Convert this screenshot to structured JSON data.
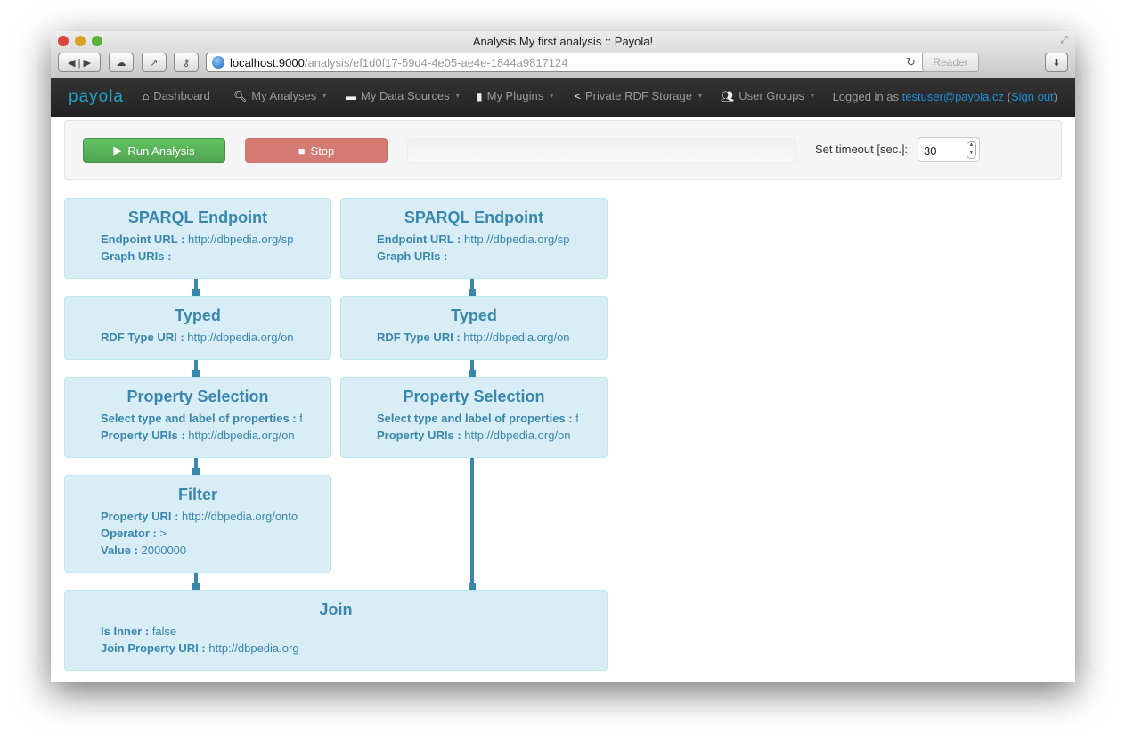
{
  "window": {
    "title": "Analysis My first analysis :: Payola!",
    "url_host": "localhost:9000",
    "url_path": "/analysis/ef1d0f17-59d4-4e05-ae4e-1844a9817124",
    "reader": "Reader"
  },
  "nav": {
    "logo": "payola",
    "items": [
      {
        "label": "Dashboard",
        "icon": "home-icon",
        "glyph": "⌂"
      },
      {
        "label": "My Analyses",
        "icon": "search-icon",
        "glyph": "🔍︎"
      },
      {
        "label": "My Data Sources",
        "icon": "hdd-icon",
        "glyph": "▬"
      },
      {
        "label": "My Plugins",
        "icon": "file-icon",
        "glyph": "▮"
      },
      {
        "label": "Private RDF Storage",
        "icon": "share-icon",
        "glyph": "<"
      },
      {
        "label": "User Groups",
        "icon": "users-icon",
        "glyph": "👥︎"
      }
    ],
    "logged_in_prefix": "Logged in as ",
    "user": "testuser@payola.cz",
    "sign_out": "Sign out"
  },
  "toolbar": {
    "run": "Run Analysis",
    "stop": "Stop",
    "progress_percent": 0,
    "timeout_label": "Set timeout [sec.]:",
    "timeout_value": "30"
  },
  "plugins": {
    "c1": [
      {
        "title": "SPARQL Endpoint",
        "props": [
          {
            "k": "Endpoint URL",
            "v": "http://dbpedia.org/sp"
          },
          {
            "k": "Graph URIs",
            "v": ""
          }
        ]
      },
      {
        "title": "Typed",
        "props": [
          {
            "k": "RDF Type URI",
            "v": "http://dbpedia.org/on"
          }
        ]
      },
      {
        "title": "Property Selection",
        "props": [
          {
            "k": "Select type and label of properties",
            "v": "f"
          },
          {
            "k": "Property URIs",
            "v": "http://dbpedia.org/on"
          }
        ]
      },
      {
        "title": "Filter",
        "props": [
          {
            "k": "Property URI",
            "v": "http://dbpedia.org/onto"
          },
          {
            "k": "Operator",
            "v": ">"
          },
          {
            "k": "Value",
            "v": "2000000"
          }
        ]
      }
    ],
    "c2": [
      {
        "title": "SPARQL Endpoint",
        "props": [
          {
            "k": "Endpoint URL",
            "v": "http://dbpedia.org/sp"
          },
          {
            "k": "Graph URIs",
            "v": ""
          }
        ]
      },
      {
        "title": "Typed",
        "props": [
          {
            "k": "RDF Type URI",
            "v": "http://dbpedia.org/on"
          }
        ]
      },
      {
        "title": "Property Selection",
        "props": [
          {
            "k": "Select type and label of properties",
            "v": "f"
          },
          {
            "k": "Property URIs",
            "v": "http://dbpedia.org/on"
          }
        ]
      }
    ],
    "join": {
      "title": "Join",
      "props": [
        {
          "k": "Is Inner",
          "v": "false"
        },
        {
          "k": "Join Property URI",
          "v": "http://dbpedia.org"
        }
      ]
    }
  },
  "colors": {
    "card_bg": "#d9edf7",
    "card_text": "#3a87ad",
    "run": "#5bb75b",
    "stop": "#d67a74",
    "link": "#1d8fd6"
  }
}
